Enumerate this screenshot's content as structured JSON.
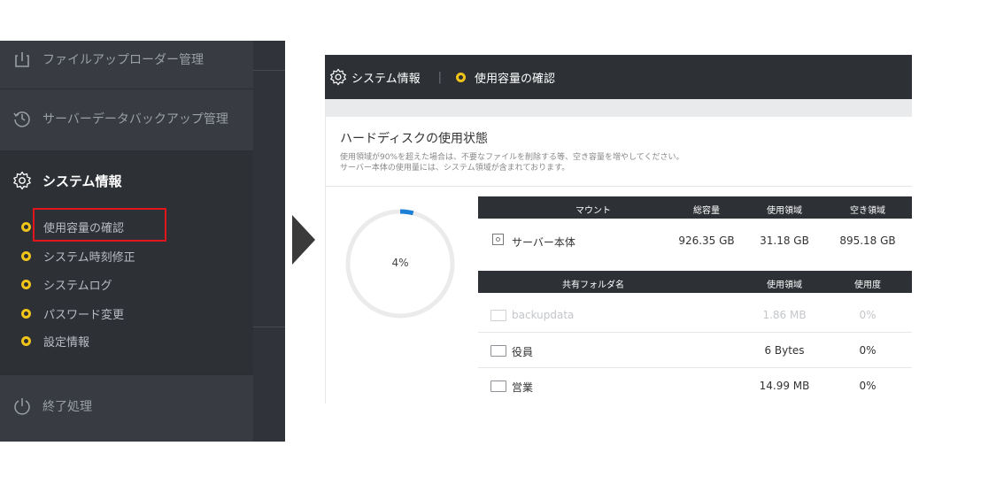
{
  "sidebar": {
    "items": [
      {
        "label": "ファイルアップローダー管理",
        "icon": "upload-icon"
      },
      {
        "label": "サーバーデータバックアップ管理",
        "icon": "backup-clock-icon"
      },
      {
        "label": "システム情報",
        "icon": "gear-icon"
      },
      {
        "label": "終了処理",
        "icon": "power-icon"
      }
    ],
    "sub_items": [
      {
        "label": "使用容量の確認"
      },
      {
        "label": "システム時刻修正"
      },
      {
        "label": "システムログ"
      },
      {
        "label": "パスワード変更"
      },
      {
        "label": "設定情報"
      }
    ],
    "highlight_color": "#e2141c",
    "bullet_color": "#f0c419"
  },
  "topbar": {
    "section": "システム情報",
    "page": "使用容量の確認"
  },
  "disk": {
    "title": "ハードディスクの使用状態",
    "note_1": "使用領域が90%を超えた場合は、不要なファイルを削除する等、空き容量を増やしてください。",
    "note_2": "サーバー本体の使用量には、システム領域が含まれております。",
    "usage_label": "4%",
    "usage_fraction": 0.04,
    "accent_color": "#1e7fd6"
  },
  "mount_table": {
    "headers": [
      "マウント",
      "総容量",
      "使用領域",
      "空き領域"
    ],
    "row": {
      "name": "サーバー本体",
      "total": "926.35 GB",
      "used": "31.18 GB",
      "free": "895.18 GB"
    }
  },
  "folder_table": {
    "headers": [
      "共有フォルダ名",
      "使用領域",
      "使用度"
    ],
    "rows": [
      {
        "name": "backupdata",
        "used": "1.86 MB",
        "ratio": "0%"
      },
      {
        "name": "役員",
        "used": "6 Bytes",
        "ratio": "0%"
      },
      {
        "name": "営業",
        "used": "14.99 MB",
        "ratio": "0%"
      }
    ]
  }
}
